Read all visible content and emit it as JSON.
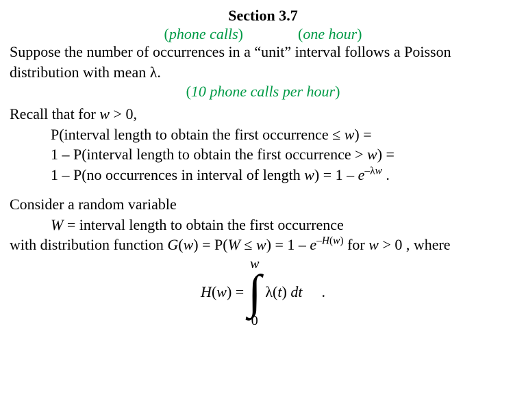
{
  "section": {
    "title": "Section 3.7",
    "annot1": "phone calls",
    "annot2": "one hour",
    "line1a": "Suppose the number of occurrences in a “unit” interval follows a Poisson",
    "line1b": "distribution with mean λ.",
    "annot3": "10 phone calls per hour",
    "recall_intro": "Recall that for ",
    "recall_cond_var": "w",
    "recall_cond_rest": " > 0,",
    "recall_l1a": "P(interval length to obtain the first occurrence ≤ ",
    "recall_l1b": "w",
    "recall_l1c": ") =",
    "recall_l2a": "1 – P(interval length to obtain the first occurrence > ",
    "recall_l2b": "w",
    "recall_l2c": ") =",
    "recall_l3a": "1 – P(no occurrences in interval of length ",
    "recall_l3b": "w",
    "recall_l3c": ") =",
    "recall_l3d": "1 – ",
    "recall_l3e": "e",
    "recall_l3exp": "–λ",
    "recall_l3exp_w": "w",
    "recall_l3f": " .",
    "consider": "Consider a random variable",
    "Wdef_var": "W",
    "Wdef_rest": " = interval length to obtain the first occurrence",
    "dist_1": "with distribution function ",
    "dist_Gw": "G",
    "dist_paren_w": "(",
    "dist_w1": "w",
    "dist_close": ") = P(",
    "dist_W": "W",
    "dist_le": " ≤ ",
    "dist_w2": "w",
    "dist_mid": ") = 1 – ",
    "dist_e": "e",
    "dist_exp_pre": "–",
    "dist_exp_H": "H",
    "dist_exp_open": "(",
    "dist_exp_w": "w",
    "dist_exp_close": ")",
    "dist_for": " for ",
    "dist_w3": "w",
    "dist_end": " > 0 , where",
    "int_Hw_H": "H",
    "int_Hw_open": "(",
    "int_Hw_w": "w",
    "int_Hw_close": ") = ",
    "int_upper": "w",
    "int_lower": "0",
    "int_lambda": "λ(",
    "int_t": "t",
    "int_close": ") ",
    "int_dt_d": "dt",
    "int_period": "."
  }
}
